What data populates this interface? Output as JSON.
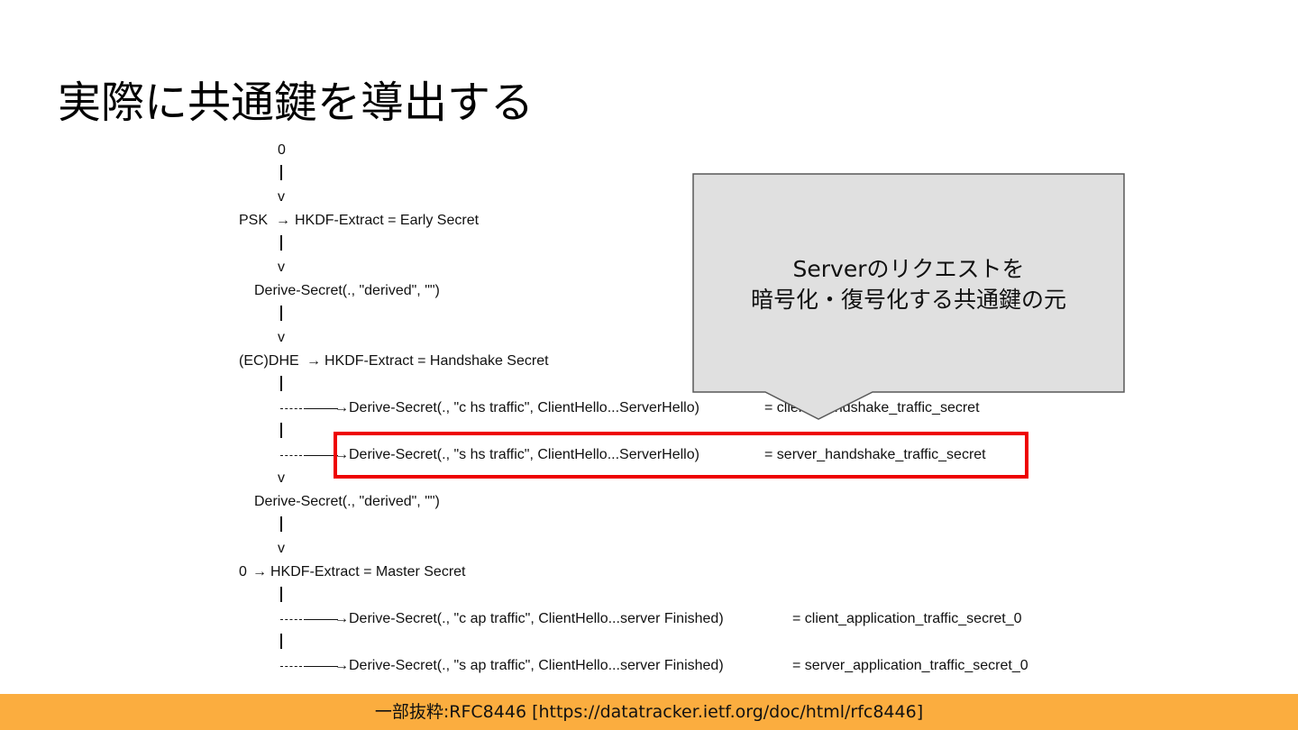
{
  "slide": {
    "title": "実際に共通鍵を導出する"
  },
  "diagram": {
    "v_marker": "v",
    "arrow_glyph": "→",
    "line_top": "0",
    "line_psk_input": "PSK",
    "line_psk_extract": "HKDF-Extract = Early Secret",
    "line_derive1": "Derive-Secret(., \"derived\", \"\")",
    "line_ecdhe_input": "(EC)DHE",
    "line_ecdhe_extract": "HKDF-Extract = Handshake Secret",
    "line_chs_call": "Derive-Secret(., \"c hs traffic\", ClientHello...ServerHello)",
    "line_chs_result": "= client_handshake_traffic_secret",
    "line_shs_call": "Derive-Secret(., \"s hs traffic\", ClientHello...ServerHello)",
    "line_shs_result": "= server_handshake_traffic_secret",
    "line_derive2": "Derive-Secret(., \"derived\", \"\")",
    "line_zero_input": "0",
    "line_master_extract": "HKDF-Extract = Master Secret",
    "line_cap_call": "Derive-Secret(., \"c ap traffic\", ClientHello...server Finished)",
    "line_cap_result": "= client_application_traffic_secret_0",
    "line_sap_call": "Derive-Secret(., \"s ap traffic\", ClientHello...server Finished)",
    "line_sap_result": "= server_application_traffic_secret_0"
  },
  "callout": {
    "line1": "Serverのリクエストを",
    "line2": "暗号化・復号化する共通鍵の元"
  },
  "footer": {
    "source": "一部抜粋:RFC8446 [https://datatracker.ietf.org/doc/html/rfc8446]"
  },
  "colors": {
    "highlight": "#ee0000",
    "footer_bar": "#fbad3f",
    "callout_fill": "#e0e0e0",
    "callout_border": "#595959"
  }
}
